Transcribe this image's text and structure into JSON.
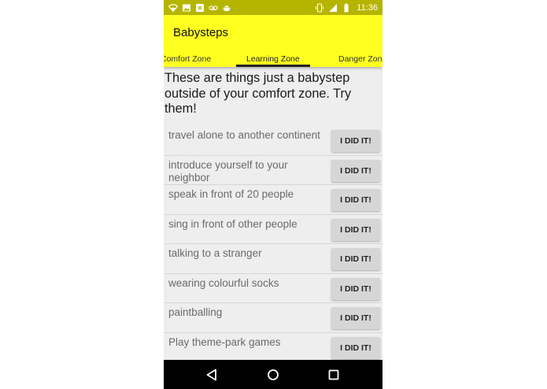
{
  "status_bar": {
    "time": "11:36",
    "left_icons": [
      "wifi-icon",
      "image-icon",
      "sync-icon",
      "voicemail-icon",
      "android-icon"
    ],
    "right_icons": [
      "vibrate-icon",
      "lte-signal-icon",
      "battery-icon"
    ]
  },
  "app_bar": {
    "title": "Babysteps",
    "background_color": "#ffff20"
  },
  "tabs": [
    {
      "label": "Comfort Zone",
      "active": false
    },
    {
      "label": "Learning Zone",
      "active": true
    },
    {
      "label": "Danger Zone",
      "active": false
    }
  ],
  "intro_text": "These are things just a babystep outside of your comfort zone. Try them!",
  "items": [
    {
      "text": "travel alone to another continent",
      "button": "I DID IT!"
    },
    {
      "text": "introduce yourself to your neighbor",
      "button": "I DID IT!"
    },
    {
      "text": "speak in front of 20 people",
      "button": "I DID IT!"
    },
    {
      "text": "sing in front of other people",
      "button": "I DID IT!"
    },
    {
      "text": "talking to a stranger",
      "button": "I DID IT!"
    },
    {
      "text": "wearing colourful socks",
      "button": "I DID IT!"
    },
    {
      "text": "paintballing",
      "button": "I DID IT!"
    },
    {
      "text": "Play theme-park games",
      "button": "I DID IT!"
    }
  ],
  "nav_bar": {
    "buttons": [
      "back-icon",
      "home-icon",
      "recents-icon"
    ]
  }
}
